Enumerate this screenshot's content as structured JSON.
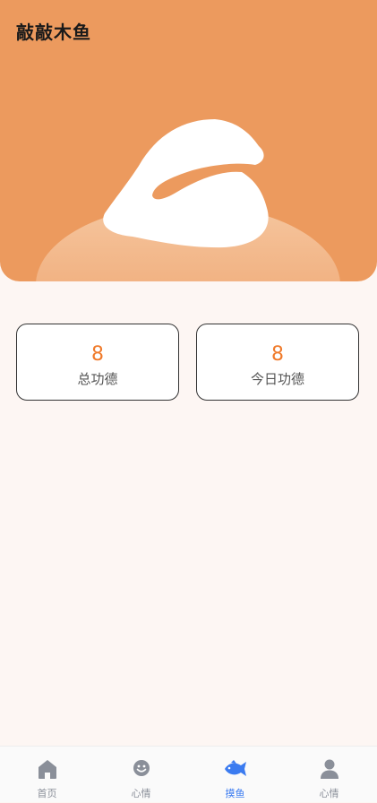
{
  "header": {
    "title": "敲敲木鱼"
  },
  "stats": [
    {
      "value": "8",
      "label": "总功德"
    },
    {
      "value": "8",
      "label": "今日功德"
    }
  ],
  "tabbar": {
    "items": [
      {
        "label": "首页",
        "icon": "home-icon",
        "active": false
      },
      {
        "label": "心情",
        "icon": "smiley-icon",
        "active": false
      },
      {
        "label": "摸鱼",
        "icon": "fish-icon",
        "active": true
      },
      {
        "label": "心情",
        "icon": "user-icon",
        "active": false
      }
    ]
  },
  "colors": {
    "hero_bg": "#ec9a5e",
    "accent": "#f07a2a",
    "active_tab": "#3b7bf0",
    "inactive_tab": "#8a8f99",
    "page_bg": "#fdf6f3"
  }
}
